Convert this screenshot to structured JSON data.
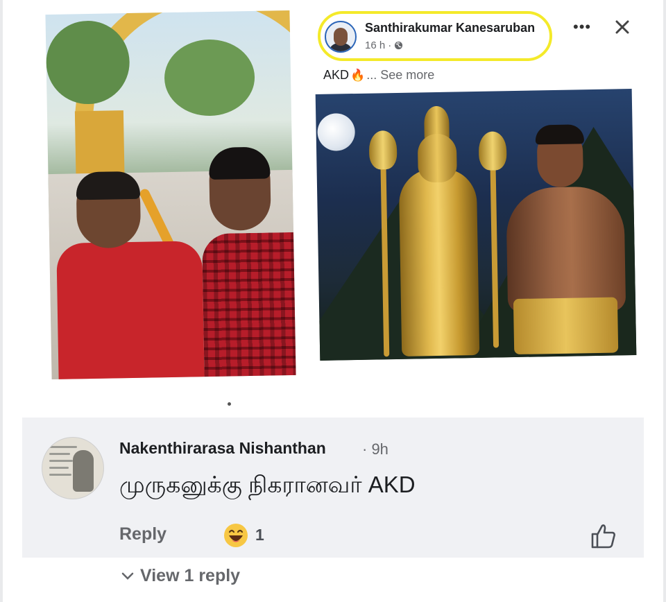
{
  "post": {
    "author": "Santhirakumar Kanesaruban",
    "time": "16 h",
    "caption": "AKD",
    "caption_emoji": "🔥",
    "see_more": "... See more",
    "more_label": "•••"
  },
  "comment": {
    "author": "Nakenthirarasa Nishanthan",
    "time": "· 9h",
    "text": "முருகனுக்கு நிகரானவர் AKD",
    "reply_label": "Reply",
    "reaction_count": "1",
    "view_replies": "View 1 reply"
  },
  "colors": {
    "highlight": "#f4ea2a",
    "comment_bg": "#f0f1f4",
    "muted_text": "#65676b"
  },
  "icons": [
    "globe-icon",
    "more-options-icon",
    "close-icon",
    "laughing-emoji-icon",
    "like-thumb-icon",
    "chevron-down-icon"
  ]
}
